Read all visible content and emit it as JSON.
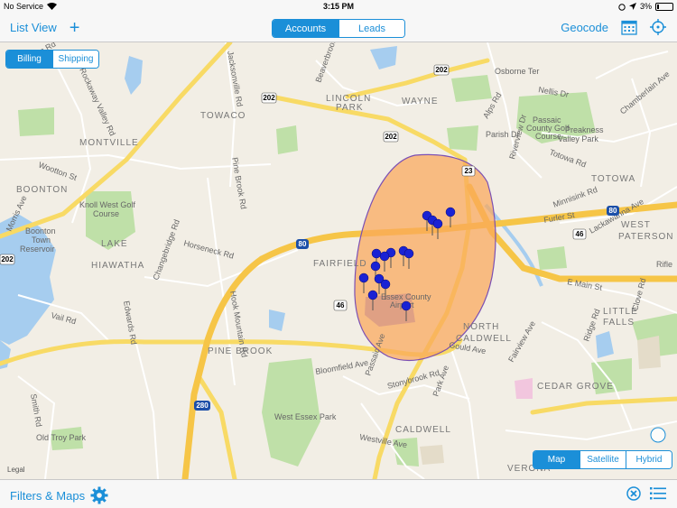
{
  "status_bar": {
    "carrier": "No Service",
    "time": "3:15 PM",
    "battery": "3%"
  },
  "nav_bar": {
    "list_view": "List View",
    "tabs": [
      {
        "label": "Accounts",
        "active": true
      },
      {
        "label": "Leads",
        "active": false
      }
    ],
    "geocode": "Geocode"
  },
  "address_toggle": [
    {
      "label": "Billing",
      "active": true
    },
    {
      "label": "Shipping",
      "active": false
    }
  ],
  "map_type": [
    {
      "label": "Map",
      "active": true
    },
    {
      "label": "Satellite",
      "active": false
    },
    {
      "label": "Hybrid",
      "active": false
    }
  ],
  "map": {
    "legal": "Legal",
    "towns": [
      "MONTVILLE",
      "BOONTON",
      "LAKE HIAWATHA",
      "TOWACO",
      "LINCOLN PARK",
      "WAYNE",
      "FAIRFIELD",
      "PINE BROOK",
      "NORTH CALDWELL",
      "CALDWELL",
      "CEDAR GROVE",
      "TOTOWA",
      "WEST PATERSON",
      "LITTLE FALLS",
      "VERONA"
    ],
    "places": [
      "Boonton Town Reservoir",
      "Knoll West Golf Course",
      "Passaic County Golf Course",
      "Preakness Valley Park",
      "West Essex Park",
      "Old Troy Park",
      "Essex County Airport",
      "Rifle Camp"
    ],
    "roads": [
      "Kinnelon Rd",
      "Rockaway Valley Rd",
      "Jacksonville Rd",
      "Beaverbrook Rd",
      "Wootton St",
      "Morris Ave",
      "Pine Brook Rd",
      "Horseneck Rd",
      "Hook Mountain Rd",
      "Changebridge Rd",
      "Vail Rd",
      "Edwards Rd",
      "Bloomfield Ave",
      "Stonybrook Rd",
      "Passaic Ave",
      "Park Ave",
      "Gould Ave",
      "Westville Ave",
      "Fairview Ave",
      "Ridge Rd",
      "Clove Rd",
      "Minnisink Rd",
      "Furler St",
      "Lackawanna Ave",
      "E Main St",
      "Alps Rd",
      "Parish Dr",
      "Riverview Dr",
      "Totowa Rd",
      "Osborne Ter",
      "Nellis Dr",
      "Smith Rd",
      "Chamberlain Ave"
    ],
    "highways": [
      "202",
      "202",
      "202",
      "202",
      "80",
      "80",
      "46",
      "46",
      "23",
      "280"
    ]
  },
  "toolbar": {
    "filters_maps": "Filters & Maps"
  }
}
